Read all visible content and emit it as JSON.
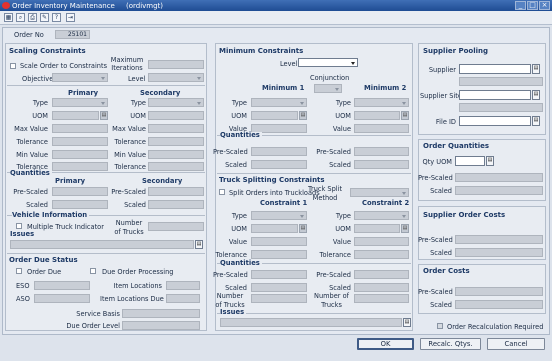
{
  "window": {
    "title": "Order Inventory Maintenance",
    "module": "(ordivmgt)",
    "min": "_",
    "max": "□",
    "close": "×"
  },
  "toolbar": {
    "items": [
      {
        "icon": "save-icon",
        "glyph": "▦"
      },
      {
        "icon": "find-icon",
        "glyph": "⌕"
      },
      {
        "icon": "print-icon",
        "glyph": "⎙"
      },
      {
        "icon": "notes-icon",
        "glyph": "✎"
      },
      {
        "icon": "help-icon",
        "glyph": "?"
      },
      {
        "icon": "exit-icon",
        "glyph": "⇥"
      }
    ]
  },
  "order": {
    "label": "Order No",
    "value": "25101"
  },
  "scaling": {
    "header": "Scaling Constraints",
    "scale_order_label": "Scale Order to Constraints",
    "objective_label": "Objective",
    "max_iterations_label": "Maximum Iterations",
    "level_label": "Level",
    "primary_header": "Primary",
    "secondary_header": "Secondary",
    "fields": [
      "Type",
      "UOM",
      "Max Value",
      "Tolerance",
      "Min Value",
      "Tolerance"
    ],
    "quantities_header": "Quantities",
    "pre_scaled_label": "Pre-Scaled",
    "scaled_label": "Scaled"
  },
  "vehicle": {
    "header": "Vehicle Information",
    "multiple_truck_label": "Multiple Truck Indicator",
    "number_of_trucks_label": "Number of Trucks"
  },
  "issues": {
    "header": "Issues"
  },
  "due": {
    "header": "Order Due Status",
    "order_due_label": "Order Due",
    "due_processing_label": "Due Order Processing",
    "eso_label": "ESO",
    "aso_label": "ASO",
    "item_locations_label": "Item Locations",
    "item_locations_due_label": "Item Locations Due",
    "service_basis_label": "Service Basis",
    "due_order_level_label": "Due Order Level"
  },
  "minimum": {
    "header": "Minimum Constraints",
    "level_label": "Level",
    "conjunction_label": "Conjunction",
    "min1_header": "Minimum 1",
    "min2_header": "Minimum 2",
    "type_label": "Type",
    "uom_label": "UOM",
    "value_label": "Value",
    "quantities_header": "Quantities",
    "pre_scaled_label": "Pre-Scaled",
    "scaled_label": "Scaled"
  },
  "truck": {
    "header": "Truck Splitting Constraints",
    "split_orders_label": "Split Orders into Truckloads",
    "split_method_label": "Truck Split Method",
    "c1_header": "Constraint 1",
    "c2_header": "Constraint 2",
    "type_label": "Type",
    "uom_label": "UOM",
    "value_label": "Value",
    "tolerance_label": "Tolerance",
    "quantities_header": "Quantities",
    "pre_scaled_label": "Pre-Scaled",
    "scaled_label": "Scaled",
    "number_of_trucks_label": "Number of Trucks",
    "issues_header": "Issues"
  },
  "supplier_pooling": {
    "header": "Supplier Pooling",
    "supplier_label": "Supplier",
    "supplier_site_label": "Supplier Site",
    "file_id_label": "File ID"
  },
  "order_quantities": {
    "header": "Order Quantities",
    "qty_uom_label": "Qty UOM",
    "pre_scaled_label": "Pre-Scaled",
    "scaled_label": "Scaled"
  },
  "supplier_costs": {
    "header": "Supplier Order Costs",
    "pre_scaled_label": "Pre-Scaled",
    "scaled_label": "Scaled"
  },
  "order_costs": {
    "header": "Order Costs",
    "pre_scaled_label": "Pre-Scaled",
    "scaled_label": "Scaled"
  },
  "recalc_required_label": "Order Recalculation Required",
  "buttons": {
    "ok": "OK",
    "recalc": "Recalc. Qtys.",
    "cancel": "Cancel"
  },
  "colors": {
    "title_bar": "#2a5ba5",
    "panel": "#e8ecf2",
    "header_text": "#1e3a66",
    "disabled_field": "#c9ced6"
  }
}
